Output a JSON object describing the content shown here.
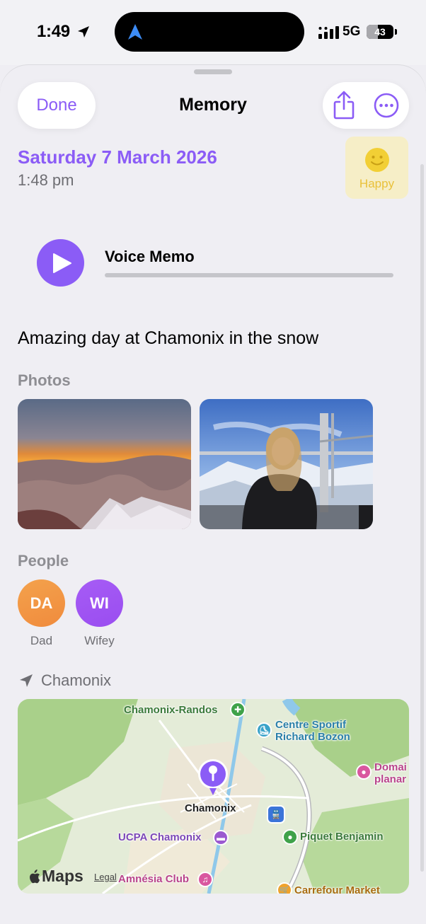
{
  "status": {
    "time": "1:49",
    "network": "5G",
    "battery": "43",
    "battery_level": 0.43
  },
  "sheet": {
    "done_label": "Done",
    "title": "Memory"
  },
  "entry": {
    "date": "Saturday 7 March 2026",
    "time": "1:48 pm",
    "mood": {
      "label": "Happy",
      "color": "#e9c13a"
    },
    "note": "Amazing day at Chamonix in the snow"
  },
  "voice_memo": {
    "title": "Voice Memo",
    "progress": 0
  },
  "photos": {
    "label": "Photos"
  },
  "people": {
    "label": "People",
    "items": [
      {
        "initials": "DA",
        "name": "Dad",
        "color": "#f08b3d"
      },
      {
        "initials": "WI",
        "name": "Wifey",
        "color": "#9a4df0"
      }
    ]
  },
  "location": {
    "name": "Chamonix",
    "map": {
      "labels": {
        "randos": "Chamonix-Randos",
        "sportif_1": "Centre Sportif",
        "sportif_2": "Richard Bozon",
        "domai_1": "Domai",
        "domai_2": "planar",
        "town": "Chamonix",
        "ucpa": "UCPA Chamonix",
        "piquet": "Piquet Benjamin",
        "amnesia": "Amnésia Club",
        "carrefour": "Carrefour Market"
      },
      "brand": "Maps",
      "legal": "Legal"
    }
  },
  "colors": {
    "accent": "#8b5cf6",
    "mood_bg": "#f6eec7"
  }
}
